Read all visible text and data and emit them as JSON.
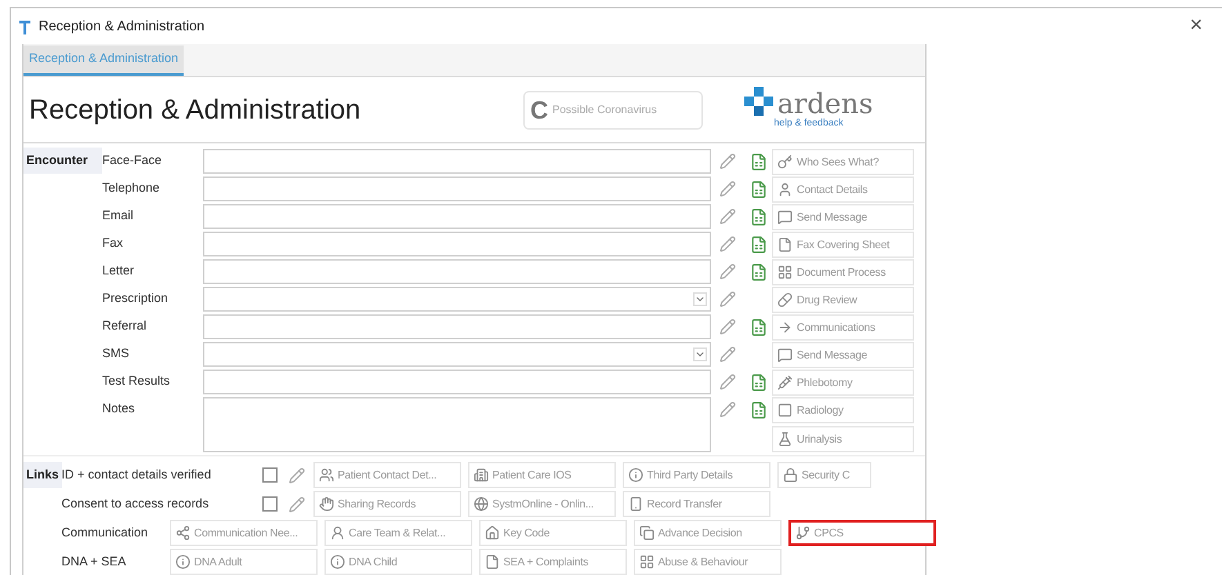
{
  "window": {
    "title": "Reception & Administration",
    "close": "×"
  },
  "tabs": [
    {
      "label": "Reception & Administration",
      "selected": true
    }
  ],
  "heading": "Reception & Administration",
  "covid_button": {
    "letter": "C",
    "label": "Possible Coronavirus"
  },
  "logo": {
    "name": "ardens",
    "tagline": "help & feedback"
  },
  "encounter": {
    "label": "Encounter",
    "rows": [
      {
        "label": "Face-Face",
        "kind": "text",
        "template": true,
        "actions": [
          "Who Sees What?"
        ]
      },
      {
        "label": "Telephone",
        "kind": "text",
        "template": true,
        "actions": [
          "Contact Details"
        ]
      },
      {
        "label": "Email",
        "kind": "text",
        "template": true,
        "actions": [
          "Send Message"
        ]
      },
      {
        "label": "Fax",
        "kind": "text",
        "template": true,
        "actions": [
          "Fax Covering Sheet"
        ]
      },
      {
        "label": "Letter",
        "kind": "text",
        "template": true,
        "actions": [
          "Document Process"
        ]
      },
      {
        "label": "Prescription",
        "kind": "dropdown",
        "template": false,
        "actions": [
          "Drug Review"
        ]
      },
      {
        "label": "Referral",
        "kind": "text",
        "template": true,
        "actions": [
          "Communications"
        ]
      },
      {
        "label": "SMS",
        "kind": "dropdown",
        "template": false,
        "actions": [
          "Send Message"
        ]
      },
      {
        "label": "Test Results",
        "kind": "text",
        "template": true,
        "actions": [
          "Phlebotomy"
        ]
      },
      {
        "label": "Notes",
        "kind": "textarea",
        "template": true,
        "actions": [
          "Radiology",
          "Urinalysis"
        ]
      }
    ]
  },
  "links": {
    "label": "Links",
    "rows": [
      {
        "label": "ID + contact details verified",
        "kind": "check",
        "checked": false,
        "buttons": [
          {
            "label": "Patient Contact Det...",
            "highlighted": false
          },
          {
            "label": "Patient Care IOS",
            "highlighted": false
          },
          {
            "label": "Third Party Details",
            "highlighted": false
          },
          {
            "label": "Security C",
            "highlighted": false
          }
        ]
      },
      {
        "label": "Consent to access records",
        "kind": "check",
        "checked": false,
        "buttons": [
          {
            "label": "Sharing Records",
            "highlighted": false
          },
          {
            "label": "SystmOnline - Onlin...",
            "highlighted": false
          },
          {
            "label": "Record Transfer",
            "highlighted": false
          }
        ]
      },
      {
        "label": "Communication",
        "kind": "plain",
        "buttons": [
          {
            "label": "Communication Nee...",
            "highlighted": false
          },
          {
            "label": "Care Team & Relat...",
            "highlighted": false
          },
          {
            "label": "Key Code",
            "highlighted": false
          },
          {
            "label": "Advance Decision",
            "highlighted": false
          },
          {
            "label": "CPCS",
            "highlighted": true
          }
        ]
      },
      {
        "label": "DNA + SEA",
        "kind": "plain",
        "buttons": [
          {
            "label": "DNA Adult",
            "highlighted": false
          },
          {
            "label": "DNA Child",
            "highlighted": false
          },
          {
            "label": "SEA + Complaints",
            "highlighted": false
          },
          {
            "label": "Abuse & Behaviour",
            "highlighted": false
          }
        ]
      }
    ]
  }
}
